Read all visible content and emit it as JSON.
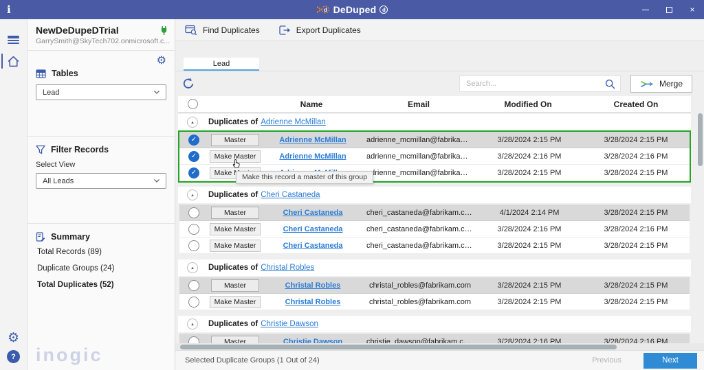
{
  "titlebar": {
    "app_initial": "i",
    "title": "DeDuped",
    "trademark": "d"
  },
  "sidebar": {
    "account_name": "NewDeDupeDTrial",
    "account_email": "GarrySmith@SkyTech702.onmicrosoft.c...",
    "tables_label": "Tables",
    "table_selected": "Lead",
    "filter_label": "Filter Records",
    "select_view_label": "Select View",
    "view_selected": "All Leads",
    "summary_label": "Summary",
    "summary_items": [
      "Total Records (89)",
      "Duplicate Groups (24)",
      "Total Duplicates (52)"
    ],
    "brand": "inogic"
  },
  "toolbar": {
    "find_label": "Find Duplicates",
    "export_label": "Export Duplicates"
  },
  "main": {
    "tab": "Lead",
    "search_placeholder": "Search...",
    "merge_label": "Merge",
    "columns": [
      "Name",
      "Email",
      "Modified On",
      "Created On"
    ],
    "tooltip": "Make this record a master of this group",
    "groups": [
      {
        "header_prefix": "Duplicates of",
        "link": "Adrienne McMillan",
        "selected": true,
        "rows": [
          {
            "checked": true,
            "master": true,
            "button": "Master",
            "name": "Adrienne McMillan",
            "email": "adrienne_mcmillan@fabrikam.com",
            "modified": "3/28/2024 2:15 PM",
            "created": "3/28/2024 2:15 PM"
          },
          {
            "checked": true,
            "master": false,
            "button": "Make Master",
            "name": "Adrienne McMillan",
            "email": "adrienne_mcmillan@fabrikam.com",
            "modified": "3/28/2024 2:16 PM",
            "created": "3/28/2024 2:16 PM"
          },
          {
            "checked": true,
            "master": false,
            "button": "Make Master",
            "name": "Adrienne McMillan",
            "email": "adrienne_mcmillan@fabrikam.com",
            "modified": "3/28/2024 2:15 PM",
            "created": "3/28/2024 2:15 PM"
          }
        ]
      },
      {
        "header_prefix": "Duplicates of",
        "link": "Cheri Castaneda",
        "selected": false,
        "rows": [
          {
            "checked": false,
            "master": true,
            "button": "Master",
            "name": "Cheri Castaneda",
            "email": "cheri_castaneda@fabrikam.com",
            "modified": "4/1/2024 2:14 PM",
            "created": "3/28/2024 2:15 PM"
          },
          {
            "checked": false,
            "master": false,
            "button": "Make Master",
            "name": "Cheri Castaneda",
            "email": "cheri_castaneda@fabrikam.com",
            "modified": "3/28/2024 2:16 PM",
            "created": "3/28/2024 2:16 PM"
          },
          {
            "checked": false,
            "master": false,
            "button": "Make Master",
            "name": "Cheri Castaneda",
            "email": "cheri_castaneda@fabrikam.com",
            "modified": "3/28/2024 2:15 PM",
            "created": "3/28/2024 2:15 PM"
          }
        ]
      },
      {
        "header_prefix": "Duplicates of",
        "link": "Christal Robles",
        "selected": false,
        "rows": [
          {
            "checked": false,
            "master": true,
            "button": "Master",
            "name": "Christal Robles",
            "email": "christal_robles@fabrikam.com",
            "modified": "3/28/2024 2:15 PM",
            "created": "3/28/2024 2:15 PM"
          },
          {
            "checked": false,
            "master": false,
            "button": "Make Master",
            "name": "Christal Robles",
            "email": "christal_robles@fabrikam.com",
            "modified": "3/28/2024 2:15 PM",
            "created": "3/28/2024 2:15 PM"
          }
        ]
      },
      {
        "header_prefix": "Duplicates of",
        "link": "Christie Dawson",
        "selected": false,
        "rows": [
          {
            "checked": false,
            "master": true,
            "button": "Master",
            "name": "Christie Dawson",
            "email": "christie_dawson@fabrikam.com",
            "modified": "3/28/2024 2:16 PM",
            "created": "3/28/2024 2:16 PM"
          }
        ]
      }
    ],
    "footer": {
      "status": "Selected Duplicate Groups (1 Out of 24)",
      "previous": "Previous",
      "next": "Next"
    }
  },
  "colors": {
    "titlebar": "#4a5aa5",
    "accent": "#3b5cab",
    "link": "#2b7cd6",
    "green": "#23a523",
    "check": "#1f6cc9",
    "nextbtn": "#2e8bd4",
    "tabline": "#5aa2e0",
    "masterrow": "#d9d9d9",
    "orange": "#e8821e",
    "brand": "#ccd3e6",
    "plug": "#2f9e3f"
  }
}
